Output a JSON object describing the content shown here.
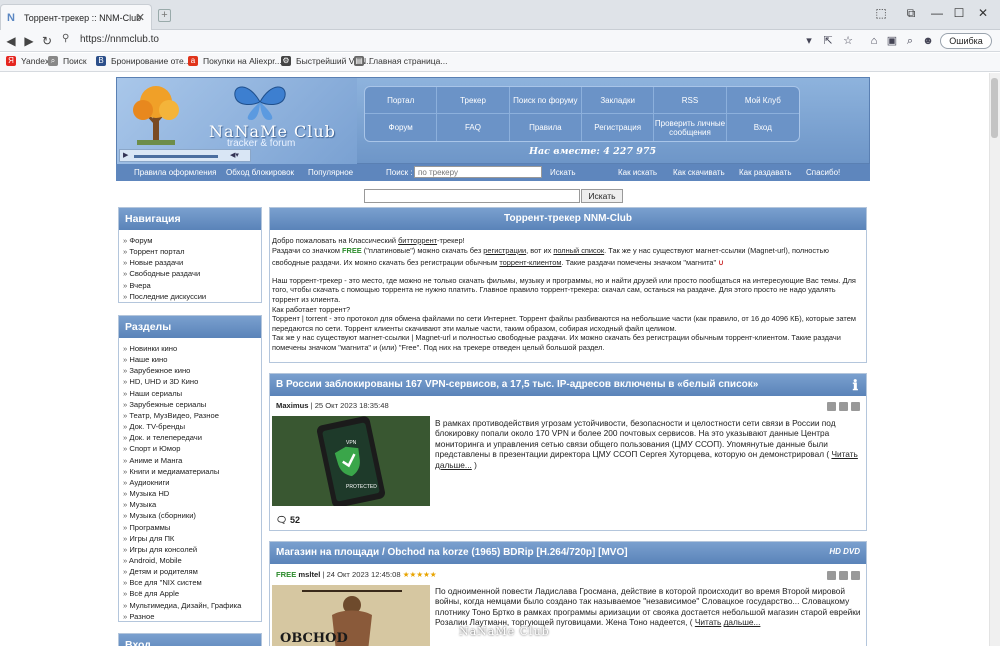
{
  "browser": {
    "tab_title": "Торрент-трекер :: NNM-Club",
    "url": "https://nnmclub.to",
    "error_label": "Ошибка",
    "bookmarks": [
      {
        "label": "Yandex",
        "icon": "yandex-icon",
        "color": "#e52620"
      },
      {
        "label": "Поиск",
        "icon": "search-icon",
        "color": "#888888"
      },
      {
        "label": "Бронирование оте...",
        "icon": "booking-icon",
        "color": "#2c4f8a"
      },
      {
        "label": "Покупки на Aliexpr...",
        "icon": "aliexpress-icon",
        "color": "#e0331a"
      },
      {
        "label": "Быстрейший VPN...",
        "icon": "vpn-icon",
        "color": "#444444"
      },
      {
        "label": "Главная страница...",
        "icon": "home-icon",
        "color": "#666666"
      }
    ]
  },
  "header": {
    "logo_text": "NaNaMe Club",
    "logo_sub": "tracker & forum",
    "menu": [
      "Портал",
      "Трекер",
      "Поиск по форуму",
      "Закладки",
      "RSS",
      "Мой Клуб",
      "Форум",
      "FAQ",
      "Правила",
      "Регистрация",
      "Проверить личные сообщения",
      "Вход"
    ],
    "online": "Нас вместе: 4 227 975"
  },
  "subnav": {
    "links": [
      "Правила оформления",
      "Обход блокировок",
      "Популярное"
    ],
    "search_label": "Поиск :",
    "search_placeholder": "по трекеру",
    "search_button": "Искать",
    "links_right": [
      "Как искать",
      "Как скачивать",
      "Как раздавать",
      "Спасибо!"
    ]
  },
  "search": {
    "button": "Искать"
  },
  "sidebar": {
    "nav_title": "Навигация",
    "nav_items": [
      "Форум",
      "Торрент портал",
      "Новые раздачи",
      "Свободные раздачи",
      "Вчера",
      "Последние дискуссии"
    ],
    "sections_title": "Разделы",
    "section_items": [
      "Новинки кино",
      "Наше кино",
      "Зарубежное кино",
      "HD, UHD и 3D Кино",
      "Наши сериалы",
      "Зарубежные сериалы",
      "Театр, МузВидео, Разное",
      "Док. TV-бренды",
      "Док. и телепередачи",
      "Спорт и Юмор",
      "Аниме и Манга",
      "Книги и медиаматериалы",
      "Аудиокниги",
      "Музыка HD",
      "Музыка",
      "Музыка (сборники)",
      "Программы",
      "Игры для ПК",
      "Игры для консолей",
      "Android, Mobile",
      "Детям и родителям",
      "Все для \"NIX систем",
      "Всё для Apple",
      "Мультимедиа, Дизайн, Графика",
      "Разное"
    ],
    "login_title": "Вход"
  },
  "main": {
    "title": "Торрент-трекер NNM-Club",
    "welcome": {
      "line1a": "Добро пожаловать на Классический ",
      "line1_link": "битторрент",
      "line1b": "-трекер!",
      "line2a": "Раздачи со значком ",
      "line2_free": "FREE",
      "line2b": " (\"платиновые\") можно скачать без ",
      "line2_link1": "регистрации",
      "line2c": ", вот их ",
      "line2_link2": "полный список",
      "line2d": ". Так же у нас существуют магнет-ссылки (Magnet-url), полностью",
      "line3a": "свободные раздачи. Их можно скачать без регистрации обычным ",
      "line3_link": "торрент-клиентом",
      "line3b": ". Такие раздачи помечены значком \"магнита\"",
      "p2": "Наш торрент-трекер - это место, где можно не только скачать фильмы, музыку и программы, но и найти друзей или просто пообщаться на интересующие Вас темы. Для того, чтобы скачать с помощью торрента не нужно платить. Главное правило торрент-трекера: скачал сам, останься на раздаче. Для этого просто не надо удалять торрент из клиента.",
      "p3": "Как работает торрент?",
      "p4": "Торрент | torrent - это протокол для обмена файлами по сети Интернет. Торрент файлы разбиваются на небольшие части (как правило, от 16 до 4096 КБ), которые затем передаются по сети. Торрент клиенты скачивают эти малые части, таким образом, собирая исходный файл целиком.",
      "p5": "Так же у нас существуют магнет-ссылки | Magnet-url и полностью свободные раздачи. Их можно скачать без регистрации обычным торрент-клиентом. Такие раздачи помечены значком \"магнита\" и (или) \"Free\". Под них на трекере отведен целый большой раздел."
    },
    "news1": {
      "title": "В России заблокированы 167 VPN-сервисов, а 17,5 тыс. IP-адресов включены в «белый список»",
      "author": "Maximus",
      "date": "| 25 Окт 2023 18:35:48",
      "text": "В рамках противодействия угрозам устойчивости, безопасности и целостности сети связи в России под блокировку попали около 170 VPN и более 200 почтовых сервисов. На это указывают данные Центра мониторинга и управления сетью связи общего пользования (ЦМУ ССОП). Упомянутые данные были представлены в презентации директора ЦМУ ССОП Сергея Хуторцева, которую он демонстрировал ( ",
      "read_more": "Читать дальше...",
      "read_end": " )",
      "comments": "52",
      "badge_vpn": "VPN",
      "badge_protected": "PROTECTED"
    },
    "news2": {
      "title": "Магазин на площади / Obchod na korze (1965) BDRip [H.264/720p] [MVO]",
      "free": "FREE",
      "author": "msltel",
      "date": "| 24 Окт 2023 12:45:08",
      "stars": "★★★★★",
      "text": "По одноименной повести Ладислава Гросмана, действие в которой происходит во время Второй мировой войны, когда немцами было создано так называемое \"независимое\" Словацкое государство... Словацкому плотнику Тоно Бртко в рамках программы ариизации от свояка достается небольшой магазин старой еврейки Розалии Лаутманн, торгующей пуговицами. Жена Тоно надеется, ( ",
      "read_more": "Читать",
      "read_more2": "дальше...",
      "hd_badge": "HD DVD",
      "poster_text": "OBCHOD"
    },
    "watermark": "NaNaMe Club"
  },
  "colors": {
    "accent": "#5a83b9",
    "free": "#2a8a2a",
    "stars": "#e8a400",
    "vpn_green": "#3aa64a"
  }
}
